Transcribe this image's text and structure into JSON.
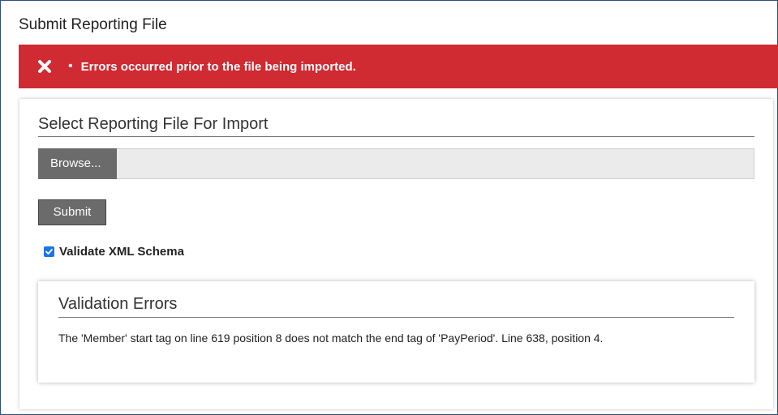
{
  "page": {
    "title": "Submit Reporting File"
  },
  "alert": {
    "icon": "error-x-icon",
    "bullet": "•",
    "message": "Errors occurred prior to the file being imported.",
    "color": "#d02a32"
  },
  "panel": {
    "title": "Select Reporting File For Import",
    "browse_label": "Browse...",
    "submit_label": "Submit",
    "checkbox": {
      "label": "Validate XML Schema",
      "checked": true
    }
  },
  "validation": {
    "title": "Validation Errors",
    "message": "The 'Member' start tag on line 619 position 8 does not match the end tag of 'PayPeriod'. Line 638, position 4."
  }
}
